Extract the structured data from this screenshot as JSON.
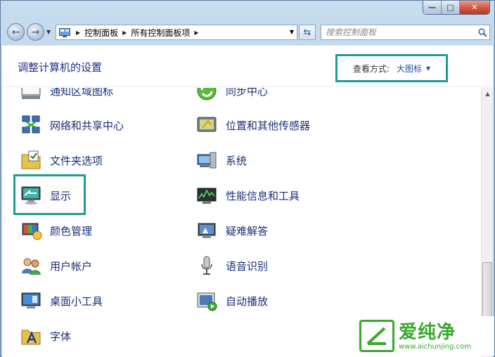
{
  "address": {
    "crumbs": [
      "控制面板",
      "所有控制面板项"
    ]
  },
  "search": {
    "placeholder": "搜索控制面板"
  },
  "header": {
    "title": "调整计算机的设置",
    "view_by_label": "查看方式:",
    "view_by_value": "大图标"
  },
  "items": [
    {
      "label": "通知区域图标",
      "icon": "notification-area-icon"
    },
    {
      "label": "同步中心",
      "icon": "sync-center-icon"
    },
    {
      "label": "网络和共享中心",
      "icon": "network-sharing-icon"
    },
    {
      "label": "位置和其他传感器",
      "icon": "location-sensors-icon"
    },
    {
      "label": "文件夹选项",
      "icon": "folder-options-icon"
    },
    {
      "label": "系统",
      "icon": "system-icon"
    },
    {
      "label": "显示",
      "icon": "display-icon"
    },
    {
      "label": "性能信息和工具",
      "icon": "performance-icon"
    },
    {
      "label": "颜色管理",
      "icon": "color-management-icon"
    },
    {
      "label": "疑难解答",
      "icon": "troubleshooting-icon"
    },
    {
      "label": "用户帐户",
      "icon": "user-accounts-icon"
    },
    {
      "label": "语音识别",
      "icon": "speech-recognition-icon"
    },
    {
      "label": "桌面小工具",
      "icon": "desktop-gadgets-icon"
    },
    {
      "label": "自动播放",
      "icon": "autoplay-icon"
    },
    {
      "label": "字体",
      "icon": "fonts-icon"
    }
  ],
  "watermark": {
    "brand": "爱纯净",
    "url": "www.aichunjing.com"
  },
  "colors": {
    "highlight": "#1f9c94",
    "link": "#1b2f7a",
    "brand": "#39a82e"
  }
}
